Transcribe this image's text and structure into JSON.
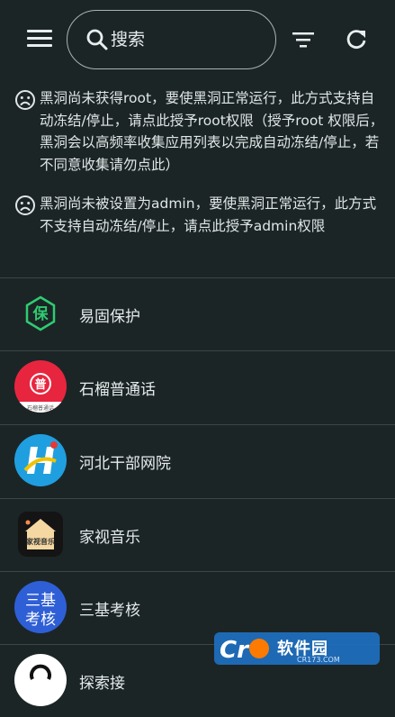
{
  "search": {
    "placeholder": "搜索"
  },
  "notices": [
    {
      "text": "黑洞尚未获得root，要使黑洞正常运行，此方式支持自动冻结/停止，请点此授予root权限（授予root 权限后，黑洞会以高频率收集应用列表以完成自动冻结/停止，若不同意收集请勿点此）"
    },
    {
      "text": "黑洞尚未被设置为admin，要使黑洞正常运行，此方式不支持自动冻结/停止，请点此授予admin权限"
    }
  ],
  "apps": [
    {
      "name": "易固保护",
      "icon_text": "保",
      "icon": "shield-hexagon-icon"
    },
    {
      "name": "石榴普通话",
      "icon_text": "普",
      "icon_caption": "石榴普通话",
      "icon": "pomegranate-icon"
    },
    {
      "name": "河北干部网院",
      "icon": "hebei-logo-icon"
    },
    {
      "name": "家视音乐",
      "icon_text": "家视音乐",
      "icon": "house-music-icon"
    },
    {
      "name": "三基考核",
      "icon_text_top": "三基",
      "icon_text_bottom": "考核",
      "icon": "sanji-icon"
    },
    {
      "name": "探索接",
      "icon": "partial-app-icon"
    }
  ],
  "watermark": {
    "text": "软件园",
    "sub": "CR173.COM",
    "brand_letter": "Cr"
  },
  "colors": {
    "background": "#1c2526",
    "divider": "#3a4647",
    "accent_green": "#2ecc71"
  }
}
